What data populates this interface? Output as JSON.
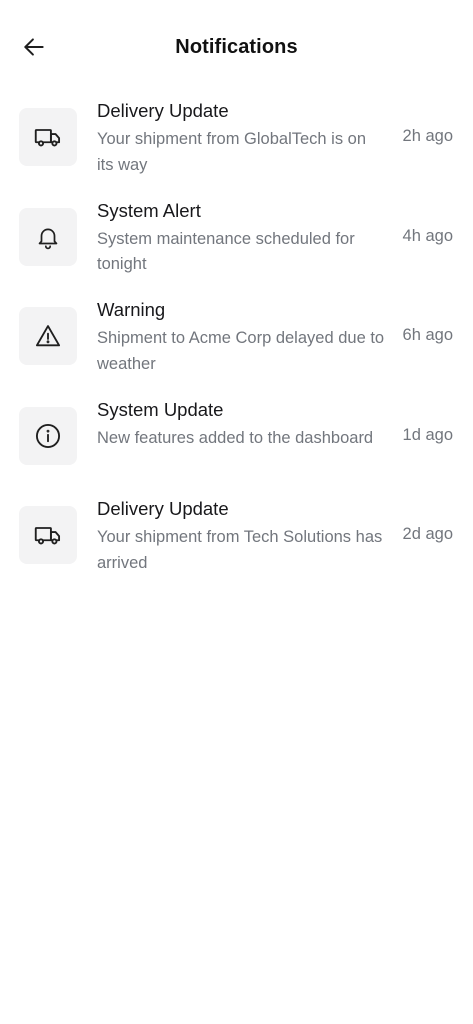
{
  "header": {
    "title": "Notifications",
    "back_icon": "arrow-left-icon"
  },
  "notifications": [
    {
      "icon": "truck-icon",
      "title": "Delivery Update",
      "message": "Your shipment from GlobalTech is on its way",
      "time": "2h ago"
    },
    {
      "icon": "bell-icon",
      "title": "System Alert",
      "message": "System maintenance scheduled for tonight",
      "time": "4h ago"
    },
    {
      "icon": "warning-triangle-icon",
      "title": "Warning",
      "message": "Shipment to Acme Corp delayed due to weather",
      "time": "6h ago"
    },
    {
      "icon": "info-circle-icon",
      "title": "System Update",
      "message": "New features added to the dashboard",
      "time": "1d ago"
    },
    {
      "icon": "truck-icon",
      "title": "Delivery Update",
      "message": "Your shipment from Tech Solutions has arrived",
      "time": "2d ago"
    }
  ],
  "colors": {
    "background": "#ffffff",
    "icon_tile": "#f3f3f4",
    "title_text": "#18181b",
    "secondary_text": "#72767d"
  }
}
